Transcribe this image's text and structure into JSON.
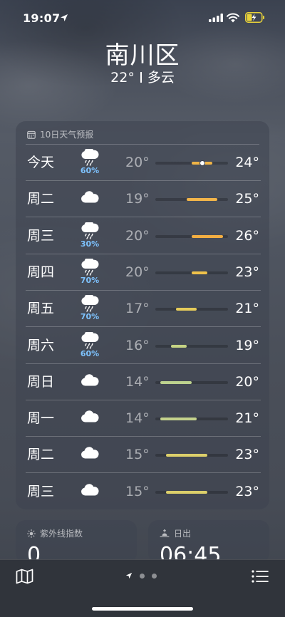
{
  "status_bar": {
    "time": "19:07"
  },
  "header": {
    "city": "南川区",
    "current_temp": "22°",
    "condition": "多云"
  },
  "forecast": {
    "title": "10日天气预报",
    "days": [
      {
        "day": "今天",
        "icon": "cloud-rain-icon",
        "precip": "60%",
        "low": "20°",
        "high": "24°",
        "bar_color": "#f0b446",
        "has_current": true
      },
      {
        "day": "周二",
        "icon": "cloud-icon",
        "precip": "",
        "low": "19°",
        "high": "25°",
        "bar_color": "#f2b54a",
        "has_current": false
      },
      {
        "day": "周三",
        "icon": "cloud-rain-icon",
        "precip": "30%",
        "low": "20°",
        "high": "26°",
        "bar_color": "#f3ae42",
        "has_current": false
      },
      {
        "day": "周四",
        "icon": "cloud-rain-icon",
        "precip": "70%",
        "low": "20°",
        "high": "23°",
        "bar_color": "#f0c24a",
        "has_current": false
      },
      {
        "day": "周五",
        "icon": "cloud-rain-icon",
        "precip": "70%",
        "low": "17°",
        "high": "21°",
        "bar_color": "#e6cc5a",
        "has_current": false
      },
      {
        "day": "周六",
        "icon": "cloud-rain-icon",
        "precip": "60%",
        "low": "16°",
        "high": "19°",
        "bar_color": "#c6d484",
        "has_current": false
      },
      {
        "day": "周日",
        "icon": "cloud-icon",
        "precip": "",
        "low": "14°",
        "high": "20°",
        "bar_color": "#bdd28e",
        "has_current": false
      },
      {
        "day": "周一",
        "icon": "cloud-icon",
        "precip": "",
        "low": "14°",
        "high": "21°",
        "bar_color": "#c4d28c",
        "has_current": false
      },
      {
        "day": "周二",
        "icon": "cloud-icon",
        "precip": "",
        "low": "15°",
        "high": "23°",
        "bar_color": "#dccf6a",
        "has_current": false
      },
      {
        "day": "周三",
        "icon": "cloud-icon",
        "precip": "",
        "low": "15°",
        "high": "23°",
        "bar_color": "#dccf6a",
        "has_current": false
      }
    ]
  },
  "uv": {
    "label": "紫外线指数",
    "value": "0"
  },
  "sunrise": {
    "label": "日出",
    "value": "06:45"
  }
}
